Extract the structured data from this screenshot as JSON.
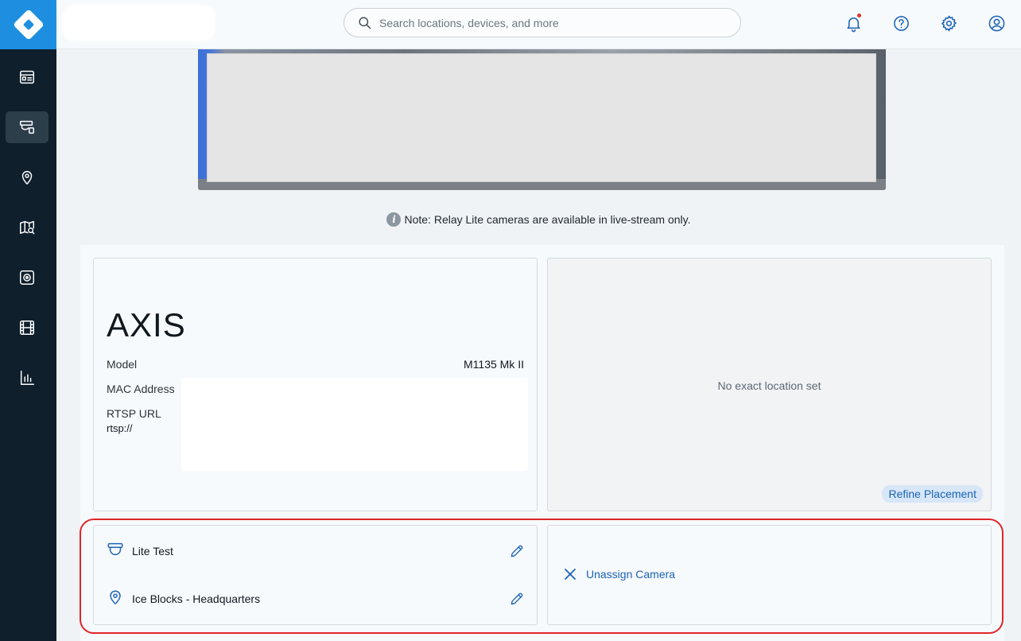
{
  "search": {
    "placeholder": "Search locations, devices, and more"
  },
  "sidebar": {
    "items": [
      {
        "icon": "dashboard-icon"
      },
      {
        "icon": "camera-device-icon",
        "active": true
      },
      {
        "icon": "location-pin-icon"
      },
      {
        "icon": "map-search-icon"
      },
      {
        "icon": "safe-vault-icon"
      },
      {
        "icon": "film-icon"
      },
      {
        "icon": "analytics-chart-icon"
      }
    ]
  },
  "topbar": {
    "icons": [
      "notification-bell-icon",
      "help-icon",
      "settings-gear-icon",
      "account-icon"
    ],
    "notification_dot_color": "#e0322b"
  },
  "note": {
    "text": "Note: Relay Lite cameras are available in live-stream only."
  },
  "device": {
    "brand": "AXIS",
    "model_label": "Model",
    "model_value": "M1135 Mk II",
    "mac_label": "MAC Address",
    "rtsp_label": "RTSP URL",
    "rtsp_value": "rtsp://"
  },
  "map": {
    "empty_text": "No exact location set",
    "refine_label": "Refine Placement"
  },
  "assignment": {
    "camera_name": "Lite Test",
    "location_name": "Ice Blocks - Headquarters",
    "unassign_label": "Unassign Camera"
  },
  "colors": {
    "accent": "#1b63b7",
    "sidebar_bg": "#0f1f2c",
    "logo_bg": "#1e8fe0",
    "highlight": "#e0242a"
  }
}
